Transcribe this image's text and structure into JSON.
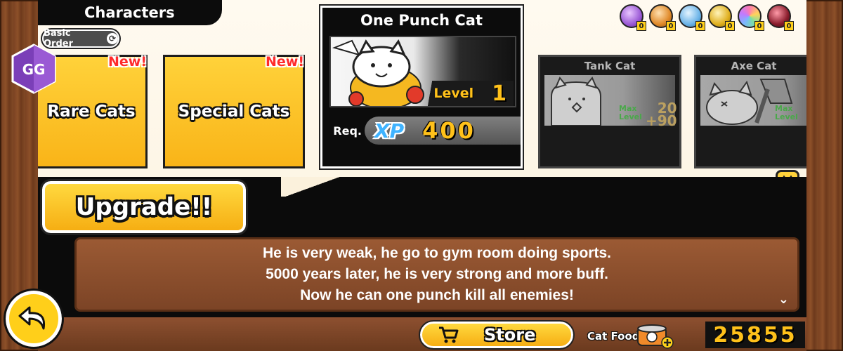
{
  "header": {
    "title": "Characters",
    "sort_label": "Basic Order"
  },
  "categories": [
    {
      "label": "Rare Cats",
      "badge": "New!"
    },
    {
      "label": "Special Cats",
      "badge": "New!"
    }
  ],
  "selected_unit": {
    "name": "One Punch Cat",
    "level_label": "Level",
    "level": "1",
    "req_label": "Req.",
    "xp_label": "XP",
    "xp_cost": "400"
  },
  "other_units": [
    {
      "name": "Tank Cat",
      "max_label": "Max\nLevel",
      "level": "20",
      "plus": "+90"
    },
    {
      "name": "Axe Cat",
      "max_label": "Max\nLevel",
      "level": "",
      "plus": ""
    }
  ],
  "orbs": [
    {
      "icon": "purple-catseye-icon",
      "color": "#9c5bd6",
      "count": "0"
    },
    {
      "icon": "orange-catseye-icon",
      "color": "#e08a2a",
      "count": "0"
    },
    {
      "icon": "blue-catseye-icon",
      "color": "#6cb4e8",
      "count": "0"
    },
    {
      "icon": "gold-catseye-icon",
      "color": "#e0b020",
      "count": "0"
    },
    {
      "icon": "rainbow-catseye-icon",
      "color": "#e86fb0",
      "count": "0"
    },
    {
      "icon": "dark-catseye-icon",
      "color": "#8a1c2c",
      "count": "0"
    }
  ],
  "upgrade_label": "Upgrade!!",
  "description": [
    "He is very weak, he go to gym room doing sports.",
    "5000 years later, he is very strong and more buff.",
    "Now he can one punch kill all enemies!"
  ],
  "footer": {
    "store_label": "Store",
    "cat_food_label": "Cat Food",
    "cat_food_value": "25855"
  },
  "overlay": {
    "gg_text": "GG"
  }
}
